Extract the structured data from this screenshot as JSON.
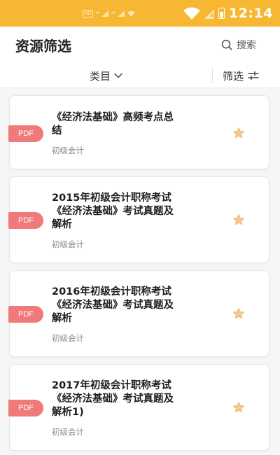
{
  "status_bar": {
    "left_hd": "HD",
    "left_sig1": "⁴⁶",
    "left_sig2": "⁴⁶",
    "time": "12:14"
  },
  "header": {
    "title": "资源筛选",
    "search_label": "搜索"
  },
  "filters": {
    "category_label": "类目",
    "screen_label": "筛选"
  },
  "resources": [
    {
      "tag": "PDF",
      "title_lines": [
        "《经济法基础》高频考点总",
        "结"
      ],
      "subtitle": "初级会计"
    },
    {
      "tag": "PDF",
      "title_lines": [
        "2015年初级会计职称考试",
        "《经济法基础》考试真题及",
        "解析"
      ],
      "subtitle": "初级会计"
    },
    {
      "tag": "PDF",
      "title_lines": [
        "2016年初级会计职称考试",
        "《经济法基础》考试真题及",
        "解析"
      ],
      "subtitle": "初级会计"
    },
    {
      "tag": "PDF",
      "title_lines": [
        "2017年初级会计职称考试",
        "《经济法基础》考试真题及",
        "解析1)"
      ],
      "subtitle": "初级会计"
    }
  ],
  "colors": {
    "status_bar": "#f7b733",
    "pdf_tag": "#f07a7a",
    "star": "#f5c98f"
  }
}
